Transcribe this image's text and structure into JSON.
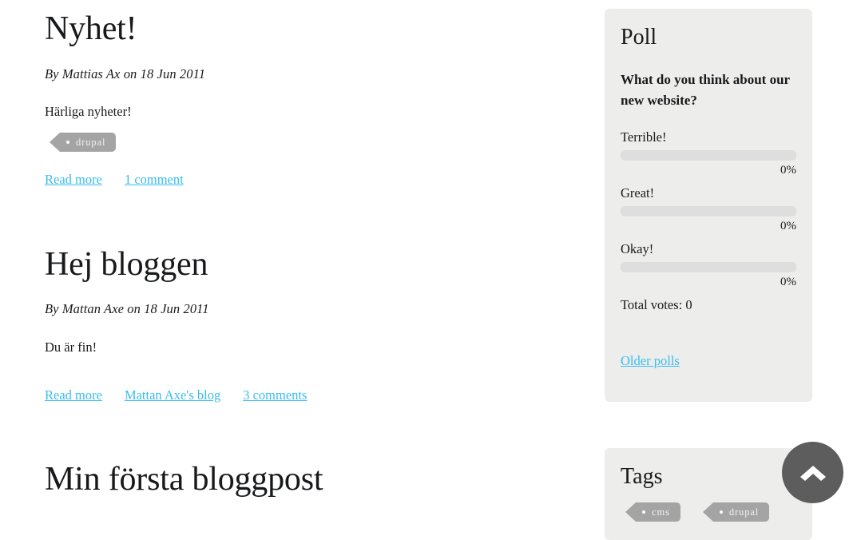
{
  "posts": [
    {
      "title": "Nyhet!",
      "submitted": "By Mattias Ax on 18 Jun 2011",
      "body": "Härliga nyheter!",
      "tags": [
        {
          "label": "drupal"
        }
      ],
      "links": [
        {
          "label": "Read more"
        },
        {
          "label": "1 comment"
        }
      ]
    },
    {
      "title": "Hej bloggen",
      "submitted": "By Mattan Axe on 18 Jun 2011",
      "body": "Du är fin!",
      "tags": [],
      "links": [
        {
          "label": "Read more"
        },
        {
          "label": "Mattan Axe's blog"
        },
        {
          "label": "3 comments"
        }
      ]
    },
    {
      "title": "Min första bloggpost",
      "submitted": "",
      "body": "",
      "tags": [],
      "links": []
    }
  ],
  "sidebar": {
    "poll": {
      "title": "Poll",
      "question": "What do you think about our new website?",
      "choices": [
        {
          "label": "Terrible!",
          "percent": "0%",
          "value": 0
        },
        {
          "label": "Great!",
          "percent": "0%",
          "value": 0
        },
        {
          "label": "Okay!",
          "percent": "0%",
          "value": 0
        }
      ],
      "total_votes_label": "Total votes: 0",
      "older_polls_label": "Older polls"
    },
    "tags_block": {
      "title": "Tags",
      "tags": [
        {
          "label": "cms"
        },
        {
          "label": "drupal"
        }
      ]
    }
  },
  "controls": {
    "back_to_top_icon": "chevron-up-icon"
  },
  "colors": {
    "link": "#38bdf1",
    "tag_background": "#a4a4a4",
    "block_background": "#ededec",
    "poll_bar": "#dedede",
    "back_to_top": "#5d5d5d"
  }
}
